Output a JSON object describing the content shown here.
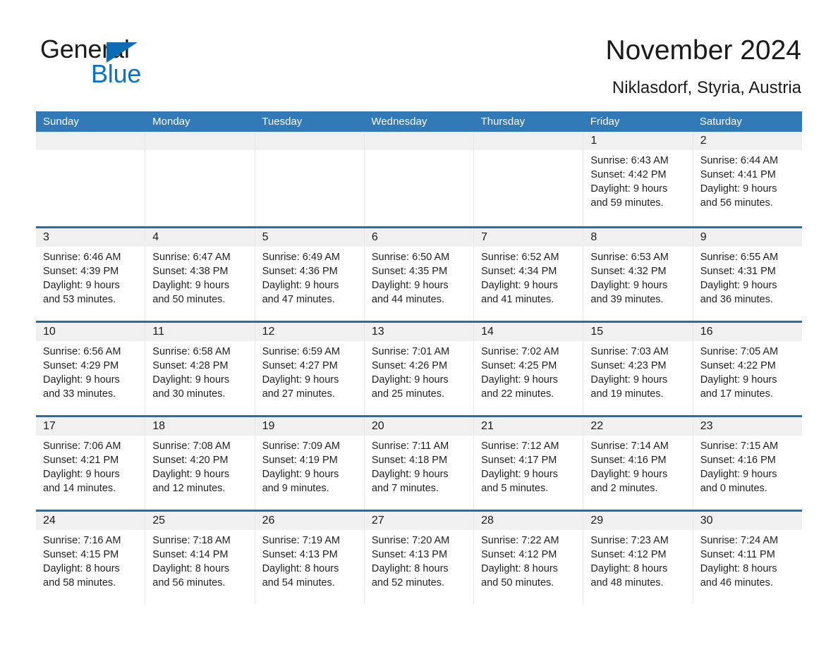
{
  "brand": {
    "name_part1": "General",
    "name_part2": "Blue",
    "triangle_icon": "blue-triangle-logo-mark",
    "color_black": "#1a1a1a",
    "color_blue": "#0b72c4"
  },
  "header": {
    "title": "November 2024",
    "subtitle": "Niklasdorf, Styria, Austria"
  },
  "theme": {
    "header_blue": "#3279b7",
    "row_divider_blue": "#2a6ca8",
    "date_band_gray": "#f0f0f0",
    "cell_white": "#ffffff",
    "text_color": "#1f1f1f"
  },
  "weekday_headers": [
    "Sunday",
    "Monday",
    "Tuesday",
    "Wednesday",
    "Thursday",
    "Friday",
    "Saturday"
  ],
  "weeks": [
    [
      {
        "day": "",
        "lines": []
      },
      {
        "day": "",
        "lines": []
      },
      {
        "day": "",
        "lines": []
      },
      {
        "day": "",
        "lines": []
      },
      {
        "day": "",
        "lines": []
      },
      {
        "day": "1",
        "lines": [
          "Sunrise: 6:43 AM",
          "Sunset: 4:42 PM",
          "Daylight: 9 hours",
          "and 59 minutes."
        ]
      },
      {
        "day": "2",
        "lines": [
          "Sunrise: 6:44 AM",
          "Sunset: 4:41 PM",
          "Daylight: 9 hours",
          "and 56 minutes."
        ]
      }
    ],
    [
      {
        "day": "3",
        "lines": [
          "Sunrise: 6:46 AM",
          "Sunset: 4:39 PM",
          "Daylight: 9 hours",
          "and 53 minutes."
        ]
      },
      {
        "day": "4",
        "lines": [
          "Sunrise: 6:47 AM",
          "Sunset: 4:38 PM",
          "Daylight: 9 hours",
          "and 50 minutes."
        ]
      },
      {
        "day": "5",
        "lines": [
          "Sunrise: 6:49 AM",
          "Sunset: 4:36 PM",
          "Daylight: 9 hours",
          "and 47 minutes."
        ]
      },
      {
        "day": "6",
        "lines": [
          "Sunrise: 6:50 AM",
          "Sunset: 4:35 PM",
          "Daylight: 9 hours",
          "and 44 minutes."
        ]
      },
      {
        "day": "7",
        "lines": [
          "Sunrise: 6:52 AM",
          "Sunset: 4:34 PM",
          "Daylight: 9 hours",
          "and 41 minutes."
        ]
      },
      {
        "day": "8",
        "lines": [
          "Sunrise: 6:53 AM",
          "Sunset: 4:32 PM",
          "Daylight: 9 hours",
          "and 39 minutes."
        ]
      },
      {
        "day": "9",
        "lines": [
          "Sunrise: 6:55 AM",
          "Sunset: 4:31 PM",
          "Daylight: 9 hours",
          "and 36 minutes."
        ]
      }
    ],
    [
      {
        "day": "10",
        "lines": [
          "Sunrise: 6:56 AM",
          "Sunset: 4:29 PM",
          "Daylight: 9 hours",
          "and 33 minutes."
        ]
      },
      {
        "day": "11",
        "lines": [
          "Sunrise: 6:58 AM",
          "Sunset: 4:28 PM",
          "Daylight: 9 hours",
          "and 30 minutes."
        ]
      },
      {
        "day": "12",
        "lines": [
          "Sunrise: 6:59 AM",
          "Sunset: 4:27 PM",
          "Daylight: 9 hours",
          "and 27 minutes."
        ]
      },
      {
        "day": "13",
        "lines": [
          "Sunrise: 7:01 AM",
          "Sunset: 4:26 PM",
          "Daylight: 9 hours",
          "and 25 minutes."
        ]
      },
      {
        "day": "14",
        "lines": [
          "Sunrise: 7:02 AM",
          "Sunset: 4:25 PM",
          "Daylight: 9 hours",
          "and 22 minutes."
        ]
      },
      {
        "day": "15",
        "lines": [
          "Sunrise: 7:03 AM",
          "Sunset: 4:23 PM",
          "Daylight: 9 hours",
          "and 19 minutes."
        ]
      },
      {
        "day": "16",
        "lines": [
          "Sunrise: 7:05 AM",
          "Sunset: 4:22 PM",
          "Daylight: 9 hours",
          "and 17 minutes."
        ]
      }
    ],
    [
      {
        "day": "17",
        "lines": [
          "Sunrise: 7:06 AM",
          "Sunset: 4:21 PM",
          "Daylight: 9 hours",
          "and 14 minutes."
        ]
      },
      {
        "day": "18",
        "lines": [
          "Sunrise: 7:08 AM",
          "Sunset: 4:20 PM",
          "Daylight: 9 hours",
          "and 12 minutes."
        ]
      },
      {
        "day": "19",
        "lines": [
          "Sunrise: 7:09 AM",
          "Sunset: 4:19 PM",
          "Daylight: 9 hours",
          "and 9 minutes."
        ]
      },
      {
        "day": "20",
        "lines": [
          "Sunrise: 7:11 AM",
          "Sunset: 4:18 PM",
          "Daylight: 9 hours",
          "and 7 minutes."
        ]
      },
      {
        "day": "21",
        "lines": [
          "Sunrise: 7:12 AM",
          "Sunset: 4:17 PM",
          "Daylight: 9 hours",
          "and 5 minutes."
        ]
      },
      {
        "day": "22",
        "lines": [
          "Sunrise: 7:14 AM",
          "Sunset: 4:16 PM",
          "Daylight: 9 hours",
          "and 2 minutes."
        ]
      },
      {
        "day": "23",
        "lines": [
          "Sunrise: 7:15 AM",
          "Sunset: 4:16 PM",
          "Daylight: 9 hours",
          "and 0 minutes."
        ]
      }
    ],
    [
      {
        "day": "24",
        "lines": [
          "Sunrise: 7:16 AM",
          "Sunset: 4:15 PM",
          "Daylight: 8 hours",
          "and 58 minutes."
        ]
      },
      {
        "day": "25",
        "lines": [
          "Sunrise: 7:18 AM",
          "Sunset: 4:14 PM",
          "Daylight: 8 hours",
          "and 56 minutes."
        ]
      },
      {
        "day": "26",
        "lines": [
          "Sunrise: 7:19 AM",
          "Sunset: 4:13 PM",
          "Daylight: 8 hours",
          "and 54 minutes."
        ]
      },
      {
        "day": "27",
        "lines": [
          "Sunrise: 7:20 AM",
          "Sunset: 4:13 PM",
          "Daylight: 8 hours",
          "and 52 minutes."
        ]
      },
      {
        "day": "28",
        "lines": [
          "Sunrise: 7:22 AM",
          "Sunset: 4:12 PM",
          "Daylight: 8 hours",
          "and 50 minutes."
        ]
      },
      {
        "day": "29",
        "lines": [
          "Sunrise: 7:23 AM",
          "Sunset: 4:12 PM",
          "Daylight: 8 hours",
          "and 48 minutes."
        ]
      },
      {
        "day": "30",
        "lines": [
          "Sunrise: 7:24 AM",
          "Sunset: 4:11 PM",
          "Daylight: 8 hours",
          "and 46 minutes."
        ]
      }
    ]
  ]
}
